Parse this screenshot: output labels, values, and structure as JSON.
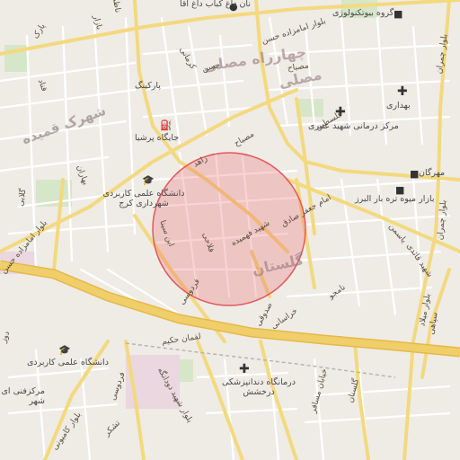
{
  "map": {
    "area_labels": {
      "chaharrah_mosalla": "چهارراه مصلی",
      "mosalla": "مصلی",
      "shahrak_ghamsideh": "شهرک قمیده",
      "golestan": "گلستان"
    },
    "poi_labels": {
      "nan_dagh": "نان داغ کباب داغ آقا",
      "biotech": "گروه بیوتکنولوژی",
      "parking": "پارکینگ",
      "gas_station": "جایگاه پرشیا",
      "behdari": "بهداری",
      "medical_center": "مرکز درمانی شهید عنبری",
      "university_karaj": "دانشگاه علمی کاربردی شهرداری کرج",
      "mehrgan": "مهرگان",
      "fruit_market": "بازار میوه تره بار البرز",
      "university_2": "دانشگاه علمی کاربردی",
      "clinic_darakhshesh": "درمانگاه دندانپزشکی درخشش",
      "markaz_fani": "مرکزفنی ای شهر"
    },
    "road_labels": {
      "r1": "بلوار امامزاده حسن",
      "r2": "بلوار امامزاده حسن",
      "r3": "قناد",
      "r4": "کرمانی",
      "r5": "بلوار چمران",
      "r6": "بلوار چمران",
      "r7": "مصباح",
      "r8": "بازار",
      "r9": "پارک",
      "r10": "ابن سینا",
      "r11": "فلاحی",
      "r12": "فردوسی",
      "r13": "لقمان حکیم",
      "r14": "فردوسی",
      "r15": "بلوار شهید دودانگه",
      "r16": "تشکر",
      "r17": "بلوار کامیونی",
      "r18": "امام جعفر صادق",
      "r19": "فلسطین",
      "r20": "خراسانی",
      "r21": "صدوقی",
      "r22": "نامجو",
      "r23": "بلوار میلاد",
      "r24": "سپاهی",
      "r25": "خیابان مسافر",
      "r26": "گلستان",
      "r27": "یاسمن",
      "r28": "شهید قائدی",
      "r29": "زاهد",
      "r30": "دوز",
      "r31": "ناظم",
      "r32": "بهاران",
      "r33": "حسن",
      "r34": "گلابی",
      "r35": "مصباح",
      "r36": "شهید فهمیده"
    },
    "icons": {
      "medical": "plus-icon",
      "education": "graduation-cap-icon",
      "fuel": "fuel-icon",
      "shopping": "shopping-icon"
    },
    "colors": {
      "background": "#efece6",
      "highway": "#f0cf6a",
      "major_road": "#f3d97f",
      "minor_road": "#ffffff",
      "highlight_circle": "#e4575f"
    }
  }
}
